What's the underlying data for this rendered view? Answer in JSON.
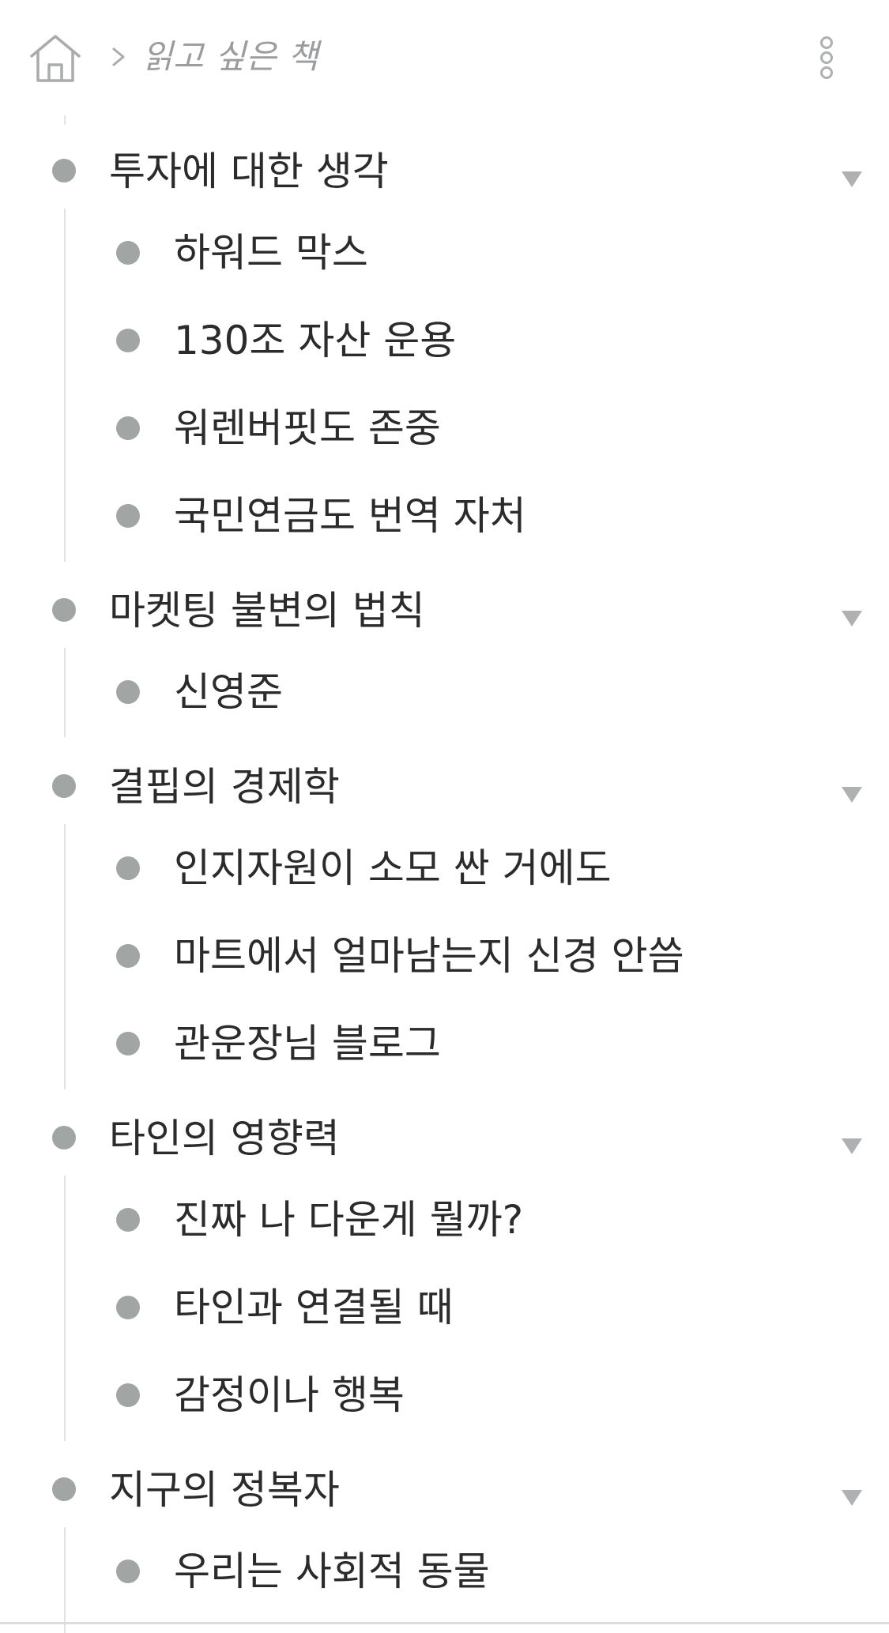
{
  "header": {
    "home_icon": "home-icon",
    "chevron_icon": "chevron-right-icon",
    "title": "읽고 싶은 책",
    "more_icon": "more-vertical-icon"
  },
  "colors": {
    "bullet": "#a1a5a4",
    "text": "#2b2b2b",
    "muted": "#9a9c9e",
    "guide": "#e2e3e4"
  },
  "outline": [
    {
      "label": "투자에 대한 생각",
      "children": [
        "하워드 막스",
        "130조 자산 운용",
        "워렌버핏도 존중",
        "국민연금도 번역 자처"
      ]
    },
    {
      "label": "마켓팅 불변의 법칙",
      "children": [
        "신영준"
      ]
    },
    {
      "label": "결핍의 경제학",
      "children": [
        "인지자원이 소모 싼 거에도",
        "마트에서 얼마남는지 신경 안씀",
        "관운장님 블로그"
      ]
    },
    {
      "label": "타인의 영향력",
      "children": [
        "진짜 나 다운게 뭘까?",
        "타인과 연결될 때",
        "감정이나 행복"
      ]
    },
    {
      "label": "지구의 정복자",
      "children": [
        "우리는 사회적 동물"
      ]
    }
  ]
}
